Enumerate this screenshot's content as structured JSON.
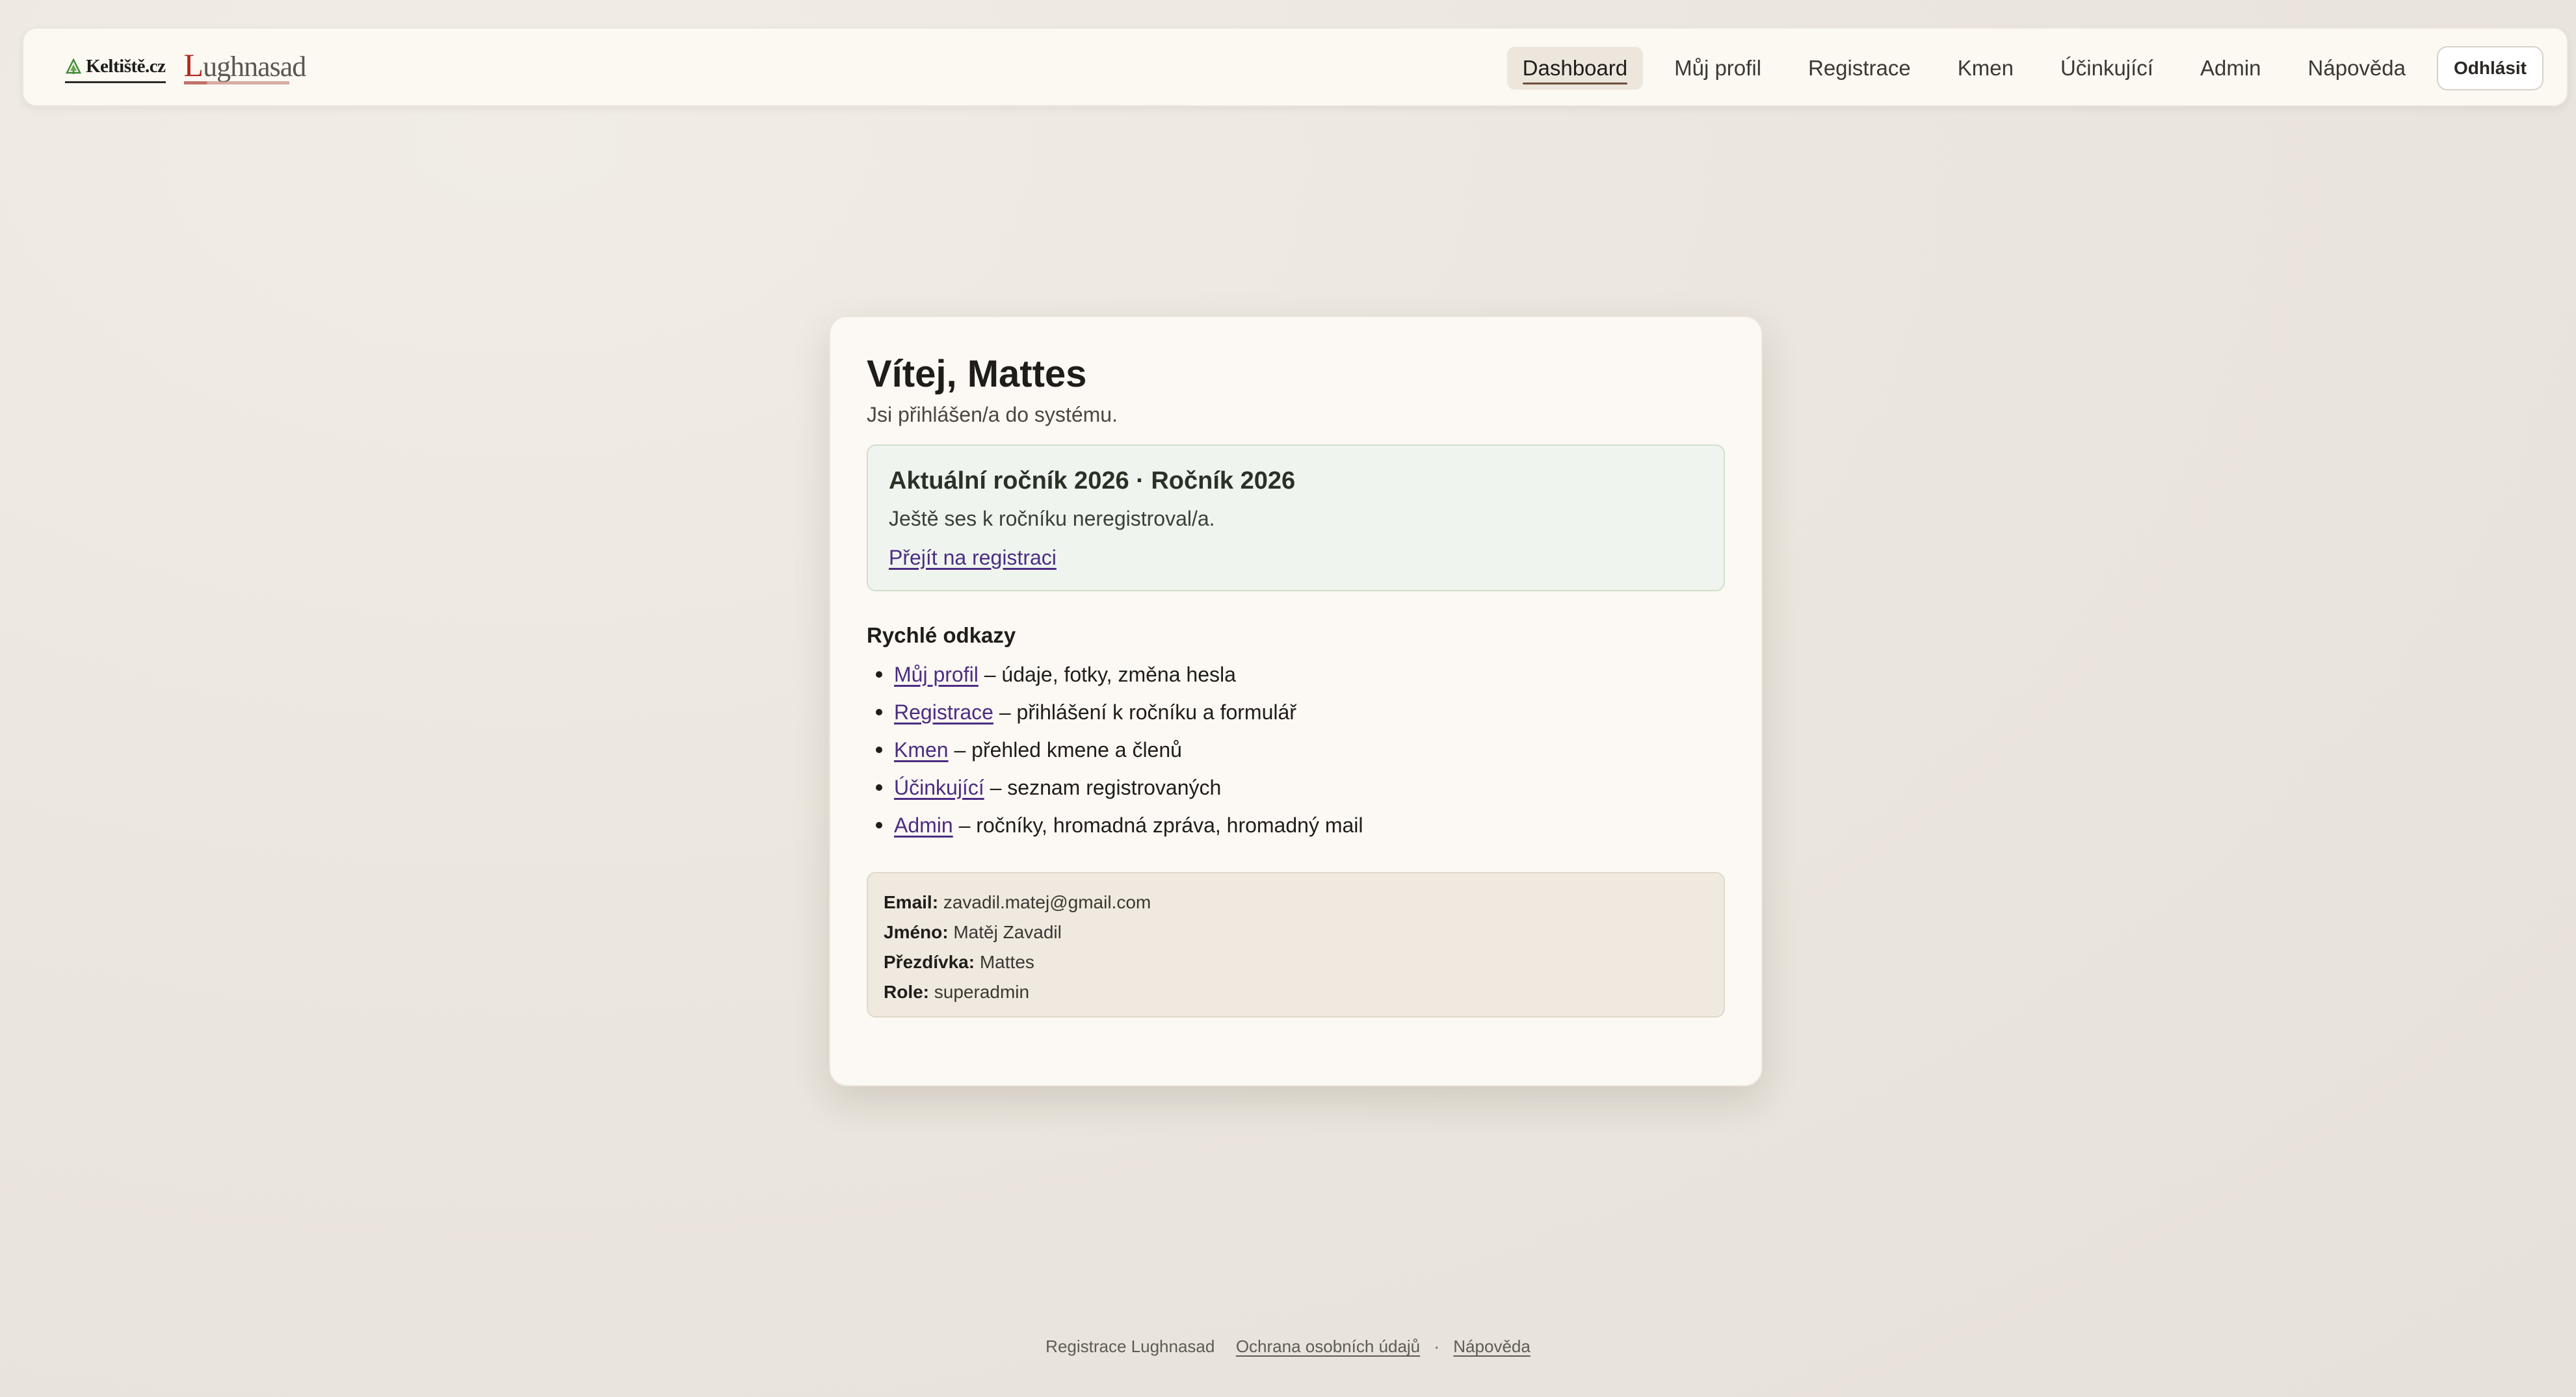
{
  "nav": {
    "brand_keltiste": "Keltiště.cz",
    "brand_lughnasad_initial": "L",
    "brand_lughnasad_rest": "ughnasad",
    "links": [
      {
        "label": "Dashboard",
        "active": true
      },
      {
        "label": "Můj profil",
        "active": false
      },
      {
        "label": "Registrace",
        "active": false
      },
      {
        "label": "Kmen",
        "active": false
      },
      {
        "label": "Účinkující",
        "active": false
      },
      {
        "label": "Admin",
        "active": false
      },
      {
        "label": "Nápověda",
        "active": false
      }
    ],
    "logout_label": "Odhlásit"
  },
  "main": {
    "title": "Vítej, Mattes",
    "subtitle": "Jsi přihlášen/a do systému.",
    "season": {
      "title": "Aktuální ročník 2026 · Ročník 2026",
      "text": "Ještě ses k ročníku neregistroval/a.",
      "link_label": "Přejít na registraci"
    },
    "quick_links": {
      "title": "Rychlé odkazy",
      "items": [
        {
          "label": "Můj profil",
          "desc": " – údaje, fotky, změna hesla"
        },
        {
          "label": "Registrace",
          "desc": " – přihlášení k ročníku a formulář"
        },
        {
          "label": "Kmen",
          "desc": " – přehled kmene a členů"
        },
        {
          "label": "Účinkující",
          "desc": " – seznam registrovaných"
        },
        {
          "label": "Admin",
          "desc": " – ročníky, hromadná zpráva, hromadný mail"
        }
      ]
    },
    "user_info": {
      "email_label": "Email:",
      "email": "zavadil.matej@gmail.com",
      "name_label": "Jméno:",
      "name": "Matěj Zavadil",
      "nickname_label": "Přezdívka:",
      "nickname": "Mattes",
      "role_label": "Role:",
      "role": "superadmin"
    }
  },
  "footer": {
    "text": "Registrace Lughnasad",
    "privacy_label": "Ochrana osobních údajů",
    "separator": "·",
    "help_label": "Nápověda"
  },
  "colors": {
    "link": "#4b2d83",
    "season_bg": "#eff5ee",
    "info_bg": "#f0e9df",
    "card_bg": "#fcf8f3",
    "page_bg": "#e9e4dc"
  }
}
